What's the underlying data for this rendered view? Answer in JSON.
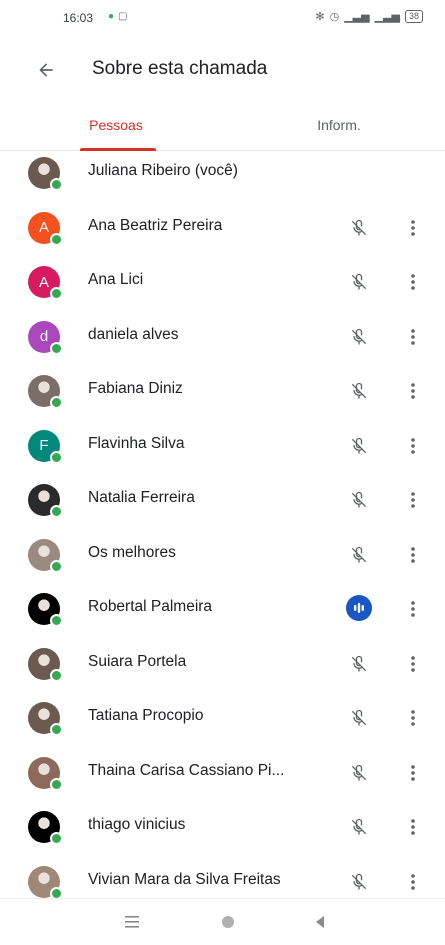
{
  "status_bar": {
    "time": "16:03",
    "left_icons": [
      "whatsapp-icon",
      "message-icon"
    ],
    "right_icons": [
      "bluetooth-icon",
      "alarm-icon",
      "signal-icon",
      "signal-icon"
    ],
    "battery": "38"
  },
  "header": {
    "back_icon": "arrow-back-icon",
    "title": "Sobre esta chamada"
  },
  "tabs": [
    {
      "label": "Pessoas",
      "active": true
    },
    {
      "label": "Inform.",
      "active": false
    }
  ],
  "colors": {
    "accent": "#d93025",
    "presence": "#34a853",
    "speaking": "#1a56c4"
  },
  "participants": [
    {
      "name": "Juliana Ribeiro (você)",
      "avatar": "photo",
      "mic": "none"
    },
    {
      "name": "Ana Beatriz Pereira",
      "avatar": "A",
      "avatar_color": "#f4511e",
      "mic": "muted"
    },
    {
      "name": "Ana Lici",
      "avatar": "A",
      "avatar_color": "#d81b60",
      "mic": "muted"
    },
    {
      "name": "daniela alves",
      "avatar": "d",
      "avatar_color": "#ab47bc",
      "mic": "muted"
    },
    {
      "name": "Fabiana Diniz",
      "avatar": "photo",
      "mic": "muted"
    },
    {
      "name": "Flavinha Silva",
      "avatar": "F",
      "avatar_color": "#00897b",
      "mic": "muted"
    },
    {
      "name": "Natalia Ferreira",
      "avatar": "photo",
      "mic": "muted"
    },
    {
      "name": "Os melhores",
      "avatar": "photo",
      "mic": "muted"
    },
    {
      "name": "Robertal Palmeira",
      "avatar": "photo",
      "mic": "speaking"
    },
    {
      "name": "Suiara Portela",
      "avatar": "photo",
      "mic": "muted"
    },
    {
      "name": "Tatiana Procopio",
      "avatar": "photo",
      "mic": "muted"
    },
    {
      "name": "Thaina Carisa Cassiano Pi...",
      "avatar": "photo",
      "mic": "muted"
    },
    {
      "name": "thiago vinicius",
      "avatar": "photo",
      "mic": "muted"
    },
    {
      "name": "Vivian Mara da Silva Freitas",
      "avatar": "photo",
      "mic": "muted"
    }
  ],
  "nav_bar": [
    "menu-icon",
    "home-icon",
    "back-triangle-icon"
  ]
}
